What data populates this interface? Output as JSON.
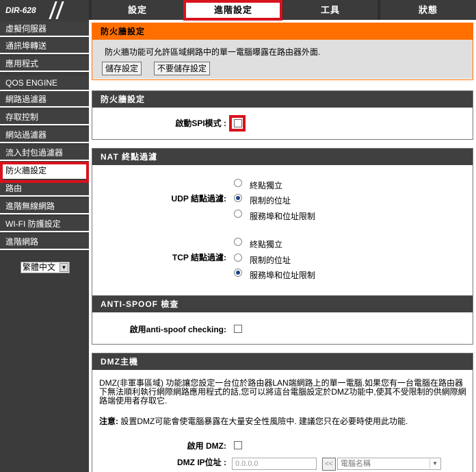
{
  "brand": {
    "model": "DIR-628"
  },
  "nav": {
    "tabs": [
      {
        "label": "設定"
      },
      {
        "label": "進階設定"
      },
      {
        "label": "工具"
      },
      {
        "label": "狀態"
      }
    ],
    "active_tab": "進階設定"
  },
  "sidebar": {
    "items": [
      {
        "label": "虛擬伺服器"
      },
      {
        "label": "通訊埠轉送"
      },
      {
        "label": "應用程式"
      },
      {
        "label": "QOS ENGINE"
      },
      {
        "label": "網路過濾器"
      },
      {
        "label": "存取控制"
      },
      {
        "label": "網站過濾器"
      },
      {
        "label": "流入封包過濾器"
      },
      {
        "label": "防火牆設定"
      },
      {
        "label": "路由"
      },
      {
        "label": "進階無線網路"
      },
      {
        "label": "WI-FI 防護設定"
      },
      {
        "label": "進階網路"
      }
    ],
    "active_item": "防火牆設定",
    "language": {
      "value": "繁體中文"
    }
  },
  "intro": {
    "title": "防火牆設定",
    "description": "防火牆功能可允許區域網路中的單一電腦曝露在路由器外面.",
    "save_label": "儲存設定",
    "dont_save_label": "不要儲存設定"
  },
  "firewall": {
    "title": "防火牆設定",
    "spi_label": "啟動SPI模式 :",
    "spi_enabled": false
  },
  "nat": {
    "title": "NAT 終點過濾",
    "udp_label": "UDP 結點過濾:",
    "tcp_label": "TCP 結點過濾:",
    "options": [
      "終點獨立",
      "限制的位址",
      "服務埠和位址限制"
    ],
    "udp_selected": "限制的位址",
    "tcp_selected": "服務埠和位址限制"
  },
  "antispoof": {
    "title": "ANTI-SPOOF 檢查",
    "label": "啟用anti-spoof checking:",
    "enabled": false
  },
  "dmz": {
    "title": "DMZ主機",
    "description": "DMZ(非軍事區域) 功能讓您設定一台位於路由器LAN端網路上的單一電腦.如果您有一台電腦在路由器下無法順利執行網際網路應用程式的話,您可以將這台電腦設定於DMZ功能中,使其不受限制的供網際網路端使用者存取它.",
    "note_prefix": "注意:",
    "note_text": " 設置DMZ可能會使電腦暴露在大量安全性風險中. 建議您只在必要時使用此功能.",
    "enable_label": "啟用 DMZ:",
    "enabled": false,
    "ip_label": "DMZ IP位址 :",
    "ip_placeholder": "0.0.0.0",
    "copy_button": "<<",
    "computer_select": "電腦名稱"
  },
  "colors": {
    "accent": "#ff6f00",
    "highlight": "#d8121e",
    "dark": "#404040"
  }
}
